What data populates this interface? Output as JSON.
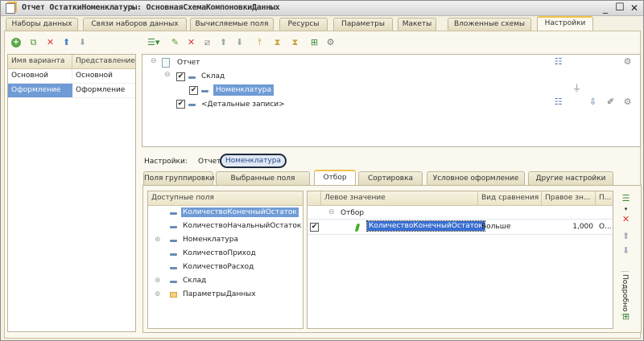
{
  "window": {
    "title": "Отчет ОстаткиНоменклатуры: ОсновнаяСхемаКомпоновкиДанных",
    "controls": [
      "_",
      "☐",
      "✕"
    ]
  },
  "tabs": [
    {
      "label": "Наборы данных"
    },
    {
      "label": "Связи наборов данных"
    },
    {
      "label": "Вычисляемые поля"
    },
    {
      "label": "Ресурсы"
    },
    {
      "label": "Параметры"
    },
    {
      "label": "Макеты"
    },
    {
      "label": "Вложенные схемы"
    },
    {
      "label": "Настройки",
      "active": true
    }
  ],
  "variants": {
    "columns": [
      "Имя варианта",
      "Представление"
    ],
    "rows": [
      [
        "Основной",
        "Основной"
      ],
      [
        "Оформление",
        "Оформление"
      ]
    ],
    "selected": 1
  },
  "structure": {
    "root": "Отчет",
    "group": "Склад",
    "subgroup": "Номенклатура",
    "details": "<Детальные записи>"
  },
  "settings_path": {
    "label": "Настройки:",
    "items": [
      "Отчет",
      "Номенклатура"
    ]
  },
  "subtabs": [
    {
      "label": "Поля группировки"
    },
    {
      "label": "Выбранные поля"
    },
    {
      "label": "Отбор",
      "active": true
    },
    {
      "label": "Сортировка"
    },
    {
      "label": "Условное оформление"
    },
    {
      "label": "Другие настройки"
    }
  ],
  "available_fields": {
    "header": "Доступные поля",
    "items": [
      "КоличествоКонечныйОстаток",
      "КоличествоНачальныйОстаток",
      "Номенклатура",
      "КоличествоПриход",
      "КоличествоРасход",
      "Склад",
      "ПараметрыДанных"
    ]
  },
  "filter": {
    "columns": [
      "Левое значение",
      "Вид сравнения",
      "Правое зн...",
      "П..."
    ],
    "group": "Отбор",
    "row": {
      "checked": true,
      "left": "КоличествоКонечныйОстаток",
      "comparison": "Больше",
      "right": "1,000",
      "p": "О..."
    }
  },
  "side_toolbar": {
    "details_label": "Подробно"
  },
  "colors": {
    "selection": "#6f9bd6",
    "active_tab_accent": "#f0c34a",
    "background": "#fbf9ef"
  }
}
